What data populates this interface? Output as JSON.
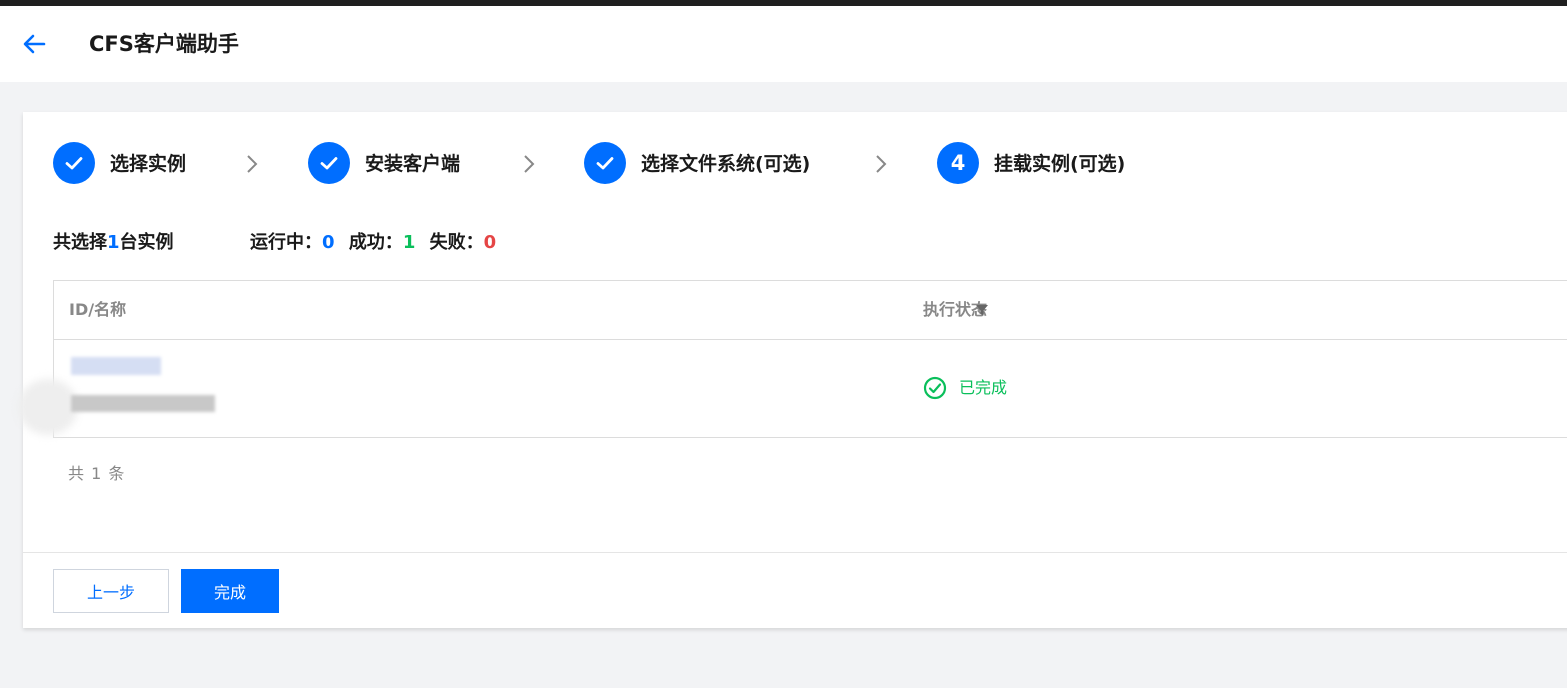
{
  "header": {
    "title": "CFS客户端助手",
    "back_icon": "arrow-left-icon"
  },
  "steps": [
    {
      "label": "选择实例",
      "state": "done",
      "marker": ""
    },
    {
      "label": "安装客户端",
      "state": "done",
      "marker": ""
    },
    {
      "label": "选择文件系统(可选)",
      "state": "done",
      "marker": ""
    },
    {
      "label": "挂载实例(可选)",
      "state": "current",
      "marker": "4"
    }
  ],
  "summary": {
    "selected_prefix": "共选择",
    "selected_count": "1",
    "selected_suffix": "台实例",
    "running_label": "运行中：",
    "running_count": "0",
    "success_label": "成功：",
    "success_count": "1",
    "failed_label": "失败：",
    "failed_count": "0"
  },
  "table": {
    "columns": [
      "ID/名称",
      "执行状态"
    ],
    "rows": [
      {
        "id": "",
        "name": "",
        "status": "已完成"
      }
    ],
    "total_text": "共 1 条"
  },
  "footer": {
    "prev_label": "上一步",
    "done_label": "完成"
  },
  "colors": {
    "primary": "#006eff",
    "success": "#0abf5b",
    "danger": "#e54545"
  }
}
